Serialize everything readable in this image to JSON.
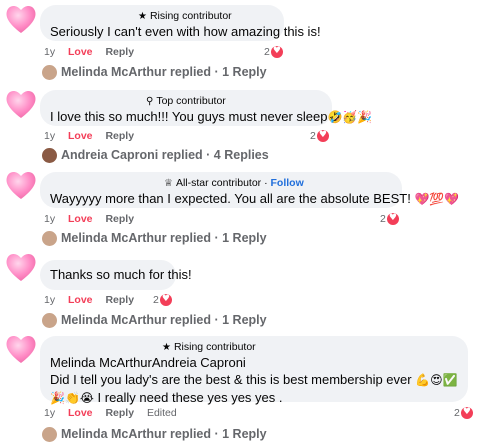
{
  "comments": [
    {
      "badge": "Rising contributor",
      "badge_icon": "star-icon",
      "text": "Seriously I can't even with how amazing this is!",
      "time": "1y",
      "love": "Love",
      "reply": "Reply",
      "reaction_count": "2",
      "replied_by": "Melinda McArthur replied · 1 Reply"
    },
    {
      "badge": "Top contributor",
      "badge_icon": "medal-icon",
      "text": "I love this so much!!! You guys must never sleep",
      "text_emoji": "🤣🥳🎉",
      "time": "1y",
      "love": "Love",
      "reply": "Reply",
      "reaction_count": "2",
      "replied_by": "Andreia Caproni replied · 4 Replies"
    },
    {
      "badge": "All-star contributor",
      "badge_icon": "trophy-icon",
      "follow": "Follow",
      "text": "Wayyyyy more than I expected. You all are the absolute BEST!",
      "text_emoji": "💖💯💖",
      "time": "1y",
      "love": "Love",
      "reply": "Reply",
      "reaction_count": "2",
      "replied_by": "Melinda McArthur replied · 1 Reply"
    },
    {
      "text": "Thanks so much for this!",
      "time": "1y",
      "love": "Love",
      "reply": "Reply",
      "reaction_count": "2",
      "replied_by": "Melinda McArthur replied · 1 Reply"
    },
    {
      "badge": "Rising contributor",
      "badge_icon": "star-icon",
      "mention": "Melinda McArthurAndreia Caproni",
      "text": "Did I tell you lady's are the best & this is best membership ever",
      "text_emoji": "💪😍✅🎉👏😭",
      "text_tail": " I really need these yes yes yes .",
      "time": "1y",
      "love": "Love",
      "reply": "Reply",
      "edited": "Edited",
      "reaction_count": "2",
      "replied_by": "Melinda McArthur replied · 1 Reply"
    }
  ],
  "colors": {
    "bubble": "#f0f2f5",
    "love": "#f33e58",
    "muted": "#65676b",
    "link": "#216fdb"
  }
}
